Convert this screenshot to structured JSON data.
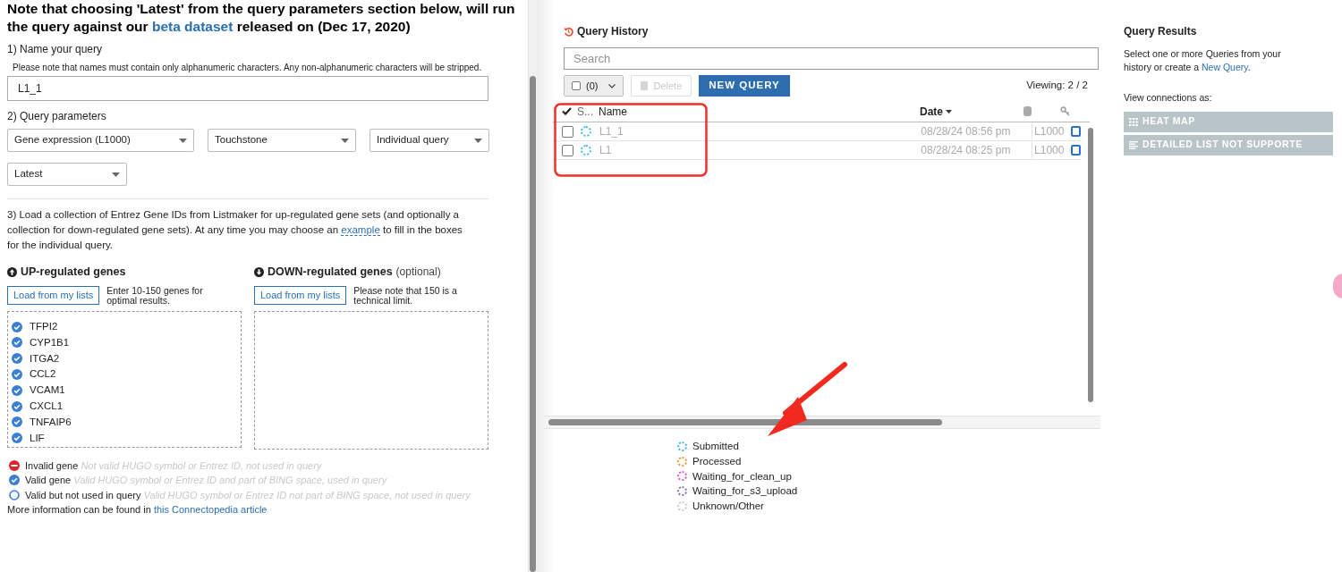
{
  "notice": {
    "line_1": "Note that choosing 'Latest' from the query parameters section below, will run",
    "before_link": "the query against our ",
    "link": "beta dataset",
    "after_link": " released on (Dec 17, 2020)"
  },
  "name_section": {
    "label": "1) Name your query",
    "hint": "Please note that names must contain only alphanumeric characters. Any non-alphanumeric characters will be stripped.",
    "value": "L1_1"
  },
  "parameters": {
    "label": "2) Query parameters",
    "dropdowns": [
      "Gene expression (L1000)",
      "Touchstone",
      "Individual query",
      "Latest"
    ]
  },
  "genes_section": {
    "before_link": "3) Load a collection of Entrez Gene IDs from Listmaker for up-regulated gene sets (and optionally a collection for down-regulated gene sets). At any time you may choose an ",
    "link": "example",
    "after_link": " to fill in the boxes for the individual query."
  },
  "up": {
    "title": "UP-regulated genes",
    "button": "Load from my lists",
    "note": "Enter 10-150 genes for optimal results.",
    "genes": [
      {
        "name": "TFPI2",
        "kind": "valid"
      },
      {
        "name": "CYP1B1",
        "kind": "valid"
      },
      {
        "name": "ITGA2",
        "kind": "valid"
      },
      {
        "name": "CCL2",
        "kind": "valid"
      },
      {
        "name": "VCAM1",
        "kind": "valid"
      },
      {
        "name": "CXCL1",
        "kind": "valid"
      },
      {
        "name": "TNFAIP6",
        "kind": "valid"
      },
      {
        "name": "LIF",
        "kind": "valid"
      }
    ]
  },
  "down": {
    "title": "DOWN-regulated genes",
    "optional": "(optional)",
    "button": "Load from my lists",
    "note": "Please note that 150 is a technical limit."
  },
  "gene_legend": [
    {
      "kind": "invalid",
      "label": "Invalid gene",
      "description": "Not valid HUGO symbol or Entrez ID, not used in query"
    },
    {
      "kind": "valid",
      "label": "Valid gene",
      "description": "Valid HUGO symbol or Entrez ID and part of BING space, used in query"
    },
    {
      "kind": "unused",
      "label": "Valid but not used in query",
      "description": "Valid HUGO symbol or Entrez ID not part of BING space, not used in query"
    }
  ],
  "more_info": {
    "text": "More information can be found in ",
    "link": "this Connectopedia article"
  },
  "history": {
    "title": "Query History",
    "search_placeholder": "Search",
    "select_checked": false,
    "select_count": "(0)",
    "delete": "Delete",
    "new_query": "NEW QUERY",
    "viewing": "Viewing: 2 / 2",
    "columns": [
      "S...",
      "Name",
      "Date"
    ],
    "rows": [
      {
        "checked": false,
        "name": "L1_1",
        "date": "08/28/24 08:56 pm",
        "type": "L1000",
        "color": "#3fb6e8"
      },
      {
        "checked": false,
        "name": "L1",
        "date": "08/28/24 08:25 pm",
        "type": "L1000",
        "color": "#3fb6e8"
      }
    ]
  },
  "status_legend": [
    {
      "label": "Submitted",
      "color": "#3fb6e8"
    },
    {
      "label": "Processed",
      "color": "#f0923a"
    },
    {
      "label": "Waiting_for_clean_up",
      "color": "#d35bc4"
    },
    {
      "label": "Waiting_for_s3_upload",
      "color": "#8a6fc0"
    },
    {
      "label": "Unknown/Other",
      "color": "#c8c8c8"
    }
  ],
  "results": {
    "title": "Query Results",
    "before_link": "Select one or more Queries from your history or create a ",
    "link": "New Query",
    "after_link": ".",
    "view_label": "View connections as:",
    "buttons": [
      {
        "kind": "grid",
        "label": "HEAT MAP",
        "disabled": true
      },
      {
        "kind": "list",
        "label": "DETAILED LIST NOT SUPPORTE",
        "disabled": true
      }
    ]
  }
}
